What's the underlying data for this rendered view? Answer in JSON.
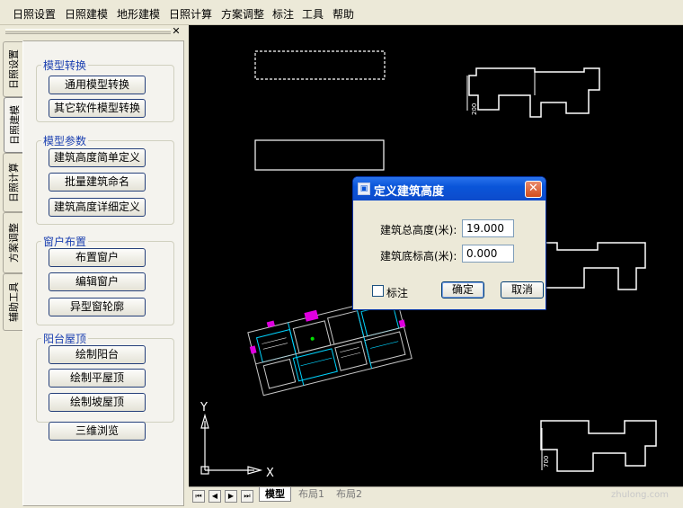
{
  "menu": [
    "日照设置",
    "日照建模",
    "地形建模",
    "日照计算",
    "方案调整",
    "标注",
    "工具",
    "帮助"
  ],
  "panel": {
    "close_glyph": "✕",
    "tabs": [
      "日照设置",
      "日照建模",
      "日照计算",
      "方案调整",
      "辅助工具"
    ],
    "groups": [
      {
        "label": "模型转换",
        "buttons": [
          "通用模型转换",
          "其它软件模型转换"
        ]
      },
      {
        "label": "模型参数",
        "buttons": [
          "建筑高度简单定义",
          "批量建筑命名",
          "建筑高度详细定义"
        ]
      },
      {
        "label": "窗户布置",
        "buttons": [
          "布置窗户",
          "编辑窗户",
          "异型窗轮廓"
        ]
      },
      {
        "label": "阳台屋顶",
        "buttons": [
          "绘制阳台",
          "绘制平屋顶",
          "绘制坡屋顶"
        ]
      }
    ],
    "standalone_button": "三维浏览"
  },
  "dialog": {
    "title": "定义建筑高度",
    "fields": [
      {
        "label": "建筑总高度(米):",
        "value": "19.000"
      },
      {
        "label": "建筑底标高(米):",
        "value": "0.000"
      }
    ],
    "checkbox_label": "标注",
    "ok_label": "确定",
    "cancel_label": "取消",
    "close_glyph": "✕"
  },
  "canvas": {
    "ucs_x": "X",
    "ucs_y": "Y",
    "dim_labels": [
      "200",
      "700"
    ]
  },
  "layout_tabs": [
    "模型",
    "布局1",
    "布局2"
  ],
  "nav_buttons": [
    "⏮",
    "◀",
    "▶",
    "⏭"
  ],
  "watermark": "zhulong.com",
  "colors": {
    "canvas_bg": "#000000",
    "title_bar": "#0a55d9",
    "close_button": "#d24d1b",
    "group_label": "#1a3fb0"
  }
}
